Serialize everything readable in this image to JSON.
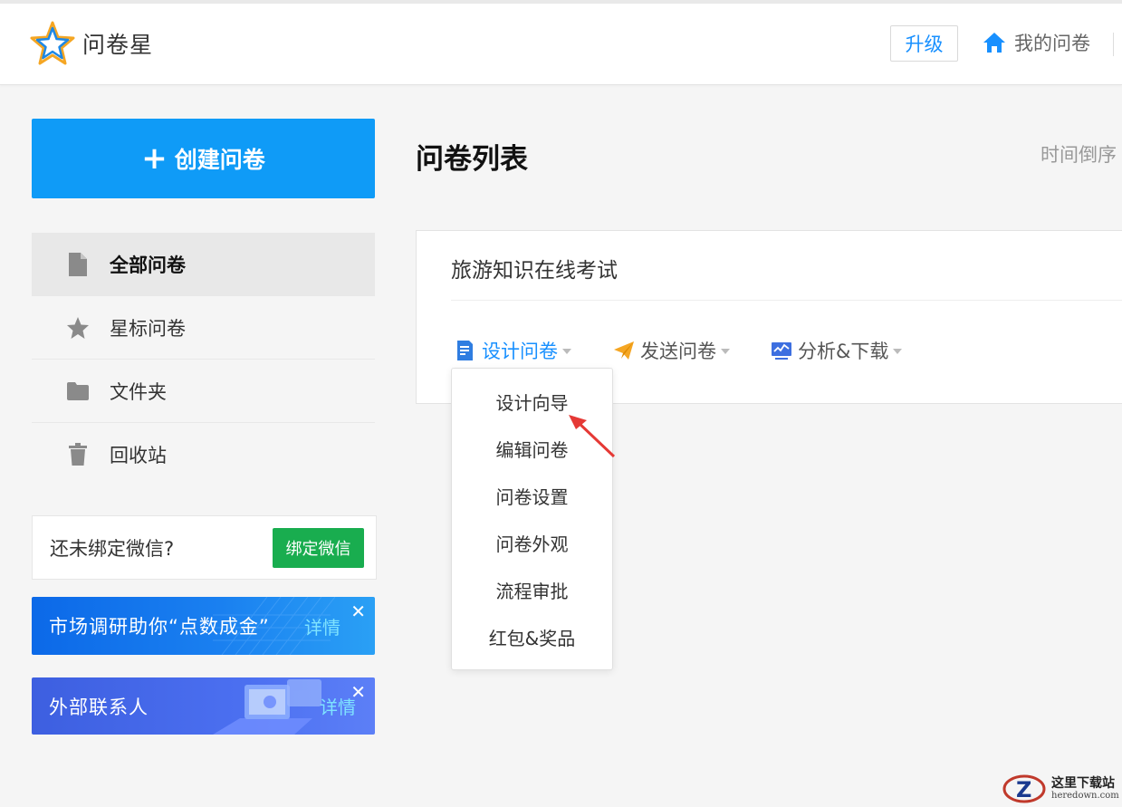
{
  "app": {
    "name": "问卷星"
  },
  "header": {
    "upgrade_label": "升级",
    "my_surveys_label": "我的问卷"
  },
  "sidebar": {
    "create_label": "创建问卷",
    "items": [
      {
        "label": "全部问卷",
        "icon": "document-icon",
        "active": true
      },
      {
        "label": "星标问卷",
        "icon": "star-icon",
        "active": false
      },
      {
        "label": "文件夹",
        "icon": "folder-icon",
        "active": false
      },
      {
        "label": "回收站",
        "icon": "trash-icon",
        "active": false
      }
    ],
    "wechat": {
      "prompt": "还未绑定微信?",
      "button_label": "绑定微信"
    },
    "banners": [
      {
        "text": "市场调研助你“点数成金”",
        "detail_label": "详情",
        "close": "✕"
      },
      {
        "text": "外部联系人",
        "detail_label": "详情",
        "close": "✕"
      }
    ]
  },
  "main": {
    "title": "问卷列表",
    "sort_label": "时间倒序",
    "survey": {
      "title": "旅游知识在线考试",
      "actions": [
        {
          "label": "设计问卷",
          "icon": "edit-document-icon"
        },
        {
          "label": "发送问卷",
          "icon": "paper-plane-icon"
        },
        {
          "label": "分析&下载",
          "icon": "chart-monitor-icon"
        }
      ]
    },
    "dropdown": {
      "items": [
        "设计向导",
        "编辑问卷",
        "问卷设置",
        "问卷外观",
        "流程审批",
        "红包&奖品"
      ]
    }
  },
  "watermark": {
    "cn": "这里下载站",
    "en": "heredown.com"
  },
  "colors": {
    "primary": "#1890ff",
    "create_button": "#0f9bf7",
    "wechat_green": "#19ad4f",
    "annotation_red": "#e53935"
  }
}
